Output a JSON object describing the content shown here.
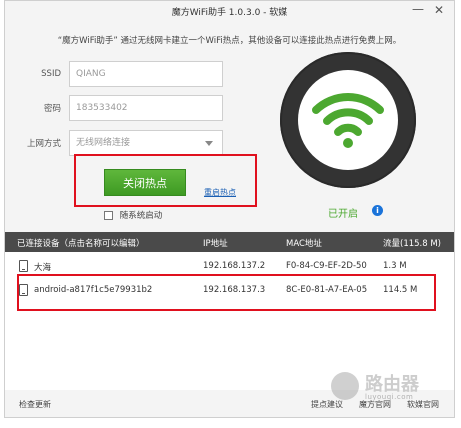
{
  "window": {
    "title": "魔方WiFi助手 1.0.3.0 - 软媒",
    "minimize_icon": "minimize-icon",
    "close_icon": "close-icon"
  },
  "description": "“魔方WiFi助手” 通过无线网卡建立一个WiFi热点，其他设备可以连接此热点进行免费上网。",
  "form": {
    "ssid_label": "SSID",
    "ssid_value": "QIANG",
    "password_label": "密码",
    "password_value": "183533402",
    "connection_label": "上网方式",
    "connection_value": "无线网络连接"
  },
  "hotspot": {
    "toggle_button": "关闭热点",
    "restart_link": "重启热点",
    "autostart_label": "随系统启动",
    "status_text": "已开启",
    "status_icon": "wifi-icon",
    "accent_color": "#4ca830",
    "info_icon": "info-icon"
  },
  "table": {
    "headers": [
      "已连接设备（点击名称可以编辑）",
      "IP地址",
      "MAC地址",
      "流量(115.8 M)"
    ],
    "rows": [
      {
        "name": "大海",
        "ip": "192.168.137.2",
        "mac": "F0-84-C9-EF-2D-50",
        "traffic": "1.3 M"
      },
      {
        "name": "android-a817f1c5e79931b2",
        "ip": "192.168.137.3",
        "mac": "8C-E0-81-A7-EA-05",
        "traffic": "114.5 M"
      }
    ]
  },
  "statusbar": {
    "check_update": "检查更新",
    "suggestion": "提点建议",
    "rubik_official": "魔方官网",
    "ruanmei_official": "软媒官网"
  },
  "watermark": {
    "text": "路由器",
    "sub": "luyouqi.com"
  }
}
